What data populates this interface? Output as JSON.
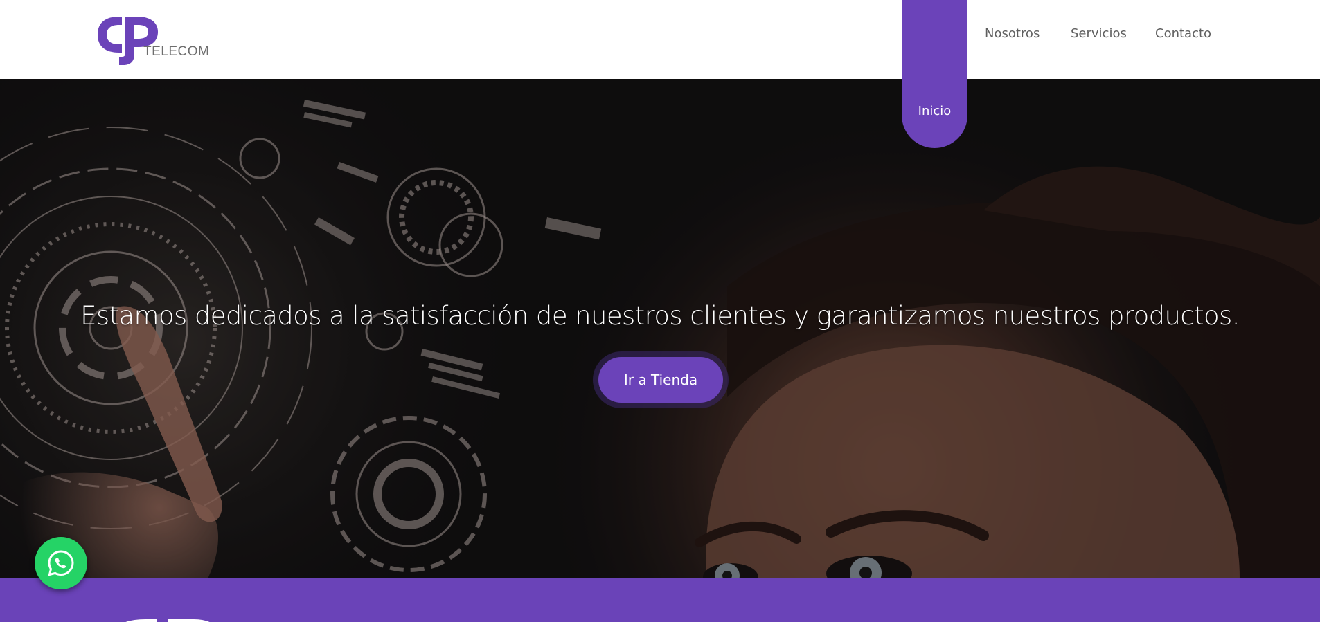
{
  "brand": {
    "logo_text": "TELECOM",
    "color": "#6b43b9"
  },
  "nav": {
    "items": [
      {
        "label": "Inicio",
        "active": true
      },
      {
        "label": "Nosotros",
        "active": false
      },
      {
        "label": "Servicios",
        "active": false
      },
      {
        "label": "Contacto",
        "active": false
      }
    ]
  },
  "hero": {
    "headline": "Estamos dedicados a la satisfacción de nuestros clientes y garantizamos nuestros productos.",
    "cta_label": "Ir a Tienda"
  },
  "widgets": {
    "whatsapp_icon": "whatsapp-icon",
    "whatsapp_color": "#25d366"
  },
  "colors": {
    "accent": "#6b43b9",
    "footer": "#6a43b8",
    "hero_dark": "#141213"
  }
}
